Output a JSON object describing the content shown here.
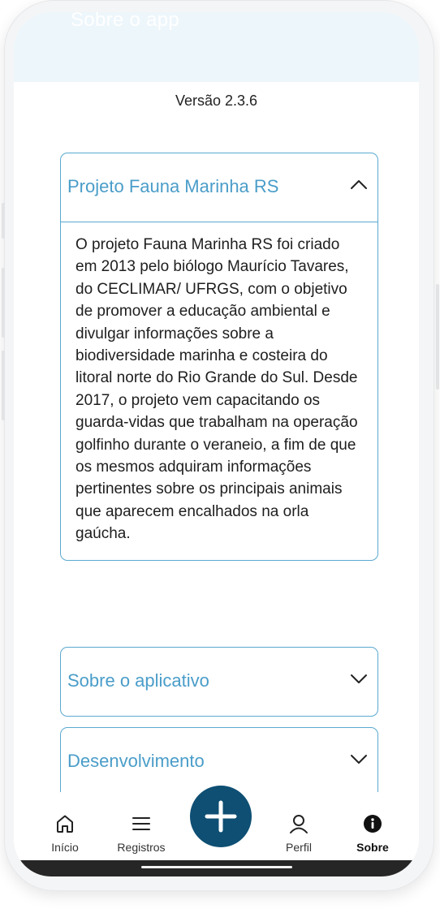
{
  "header": {
    "title": "Sobre o app"
  },
  "version_text": "Versão 2.3.6",
  "sections": [
    {
      "title": "Projeto Fauna Marinha RS",
      "expanded": true,
      "body": "O projeto Fauna Marinha RS foi criado em 2013 pelo biólogo Maurício Tavares, do CECLIMAR/ UFRGS, com o objetivo de promover a educação ambiental e divulgar informações sobre a biodiversidade marinha e costeira do litoral norte do Rio Grande do Sul. Desde 2017, o projeto vem capacitando os guarda-vidas que trabalham na operação golfinho durante o veraneio, a fim de que os mesmos adquiram informações pertinentes sobre os principais animais que aparecem encalhados na orla gaúcha."
    },
    {
      "title": "Sobre o aplicativo",
      "expanded": false
    },
    {
      "title": "Desenvolvimento",
      "expanded": false
    }
  ],
  "nav": {
    "items": [
      {
        "label": "Início",
        "icon": "home-icon",
        "active": false
      },
      {
        "label": "Registros",
        "icon": "menu-icon",
        "active": false
      },
      {
        "label": "Perfil",
        "icon": "user-icon",
        "active": false
      },
      {
        "label": "Sobre",
        "icon": "info-icon",
        "active": true
      }
    ],
    "fab_icon": "plus-icon"
  },
  "colors": {
    "accent": "#4a9dc9",
    "card_border": "#5aa9d0",
    "fab": "#0e4f73",
    "header_bg": "#edf6fb"
  }
}
